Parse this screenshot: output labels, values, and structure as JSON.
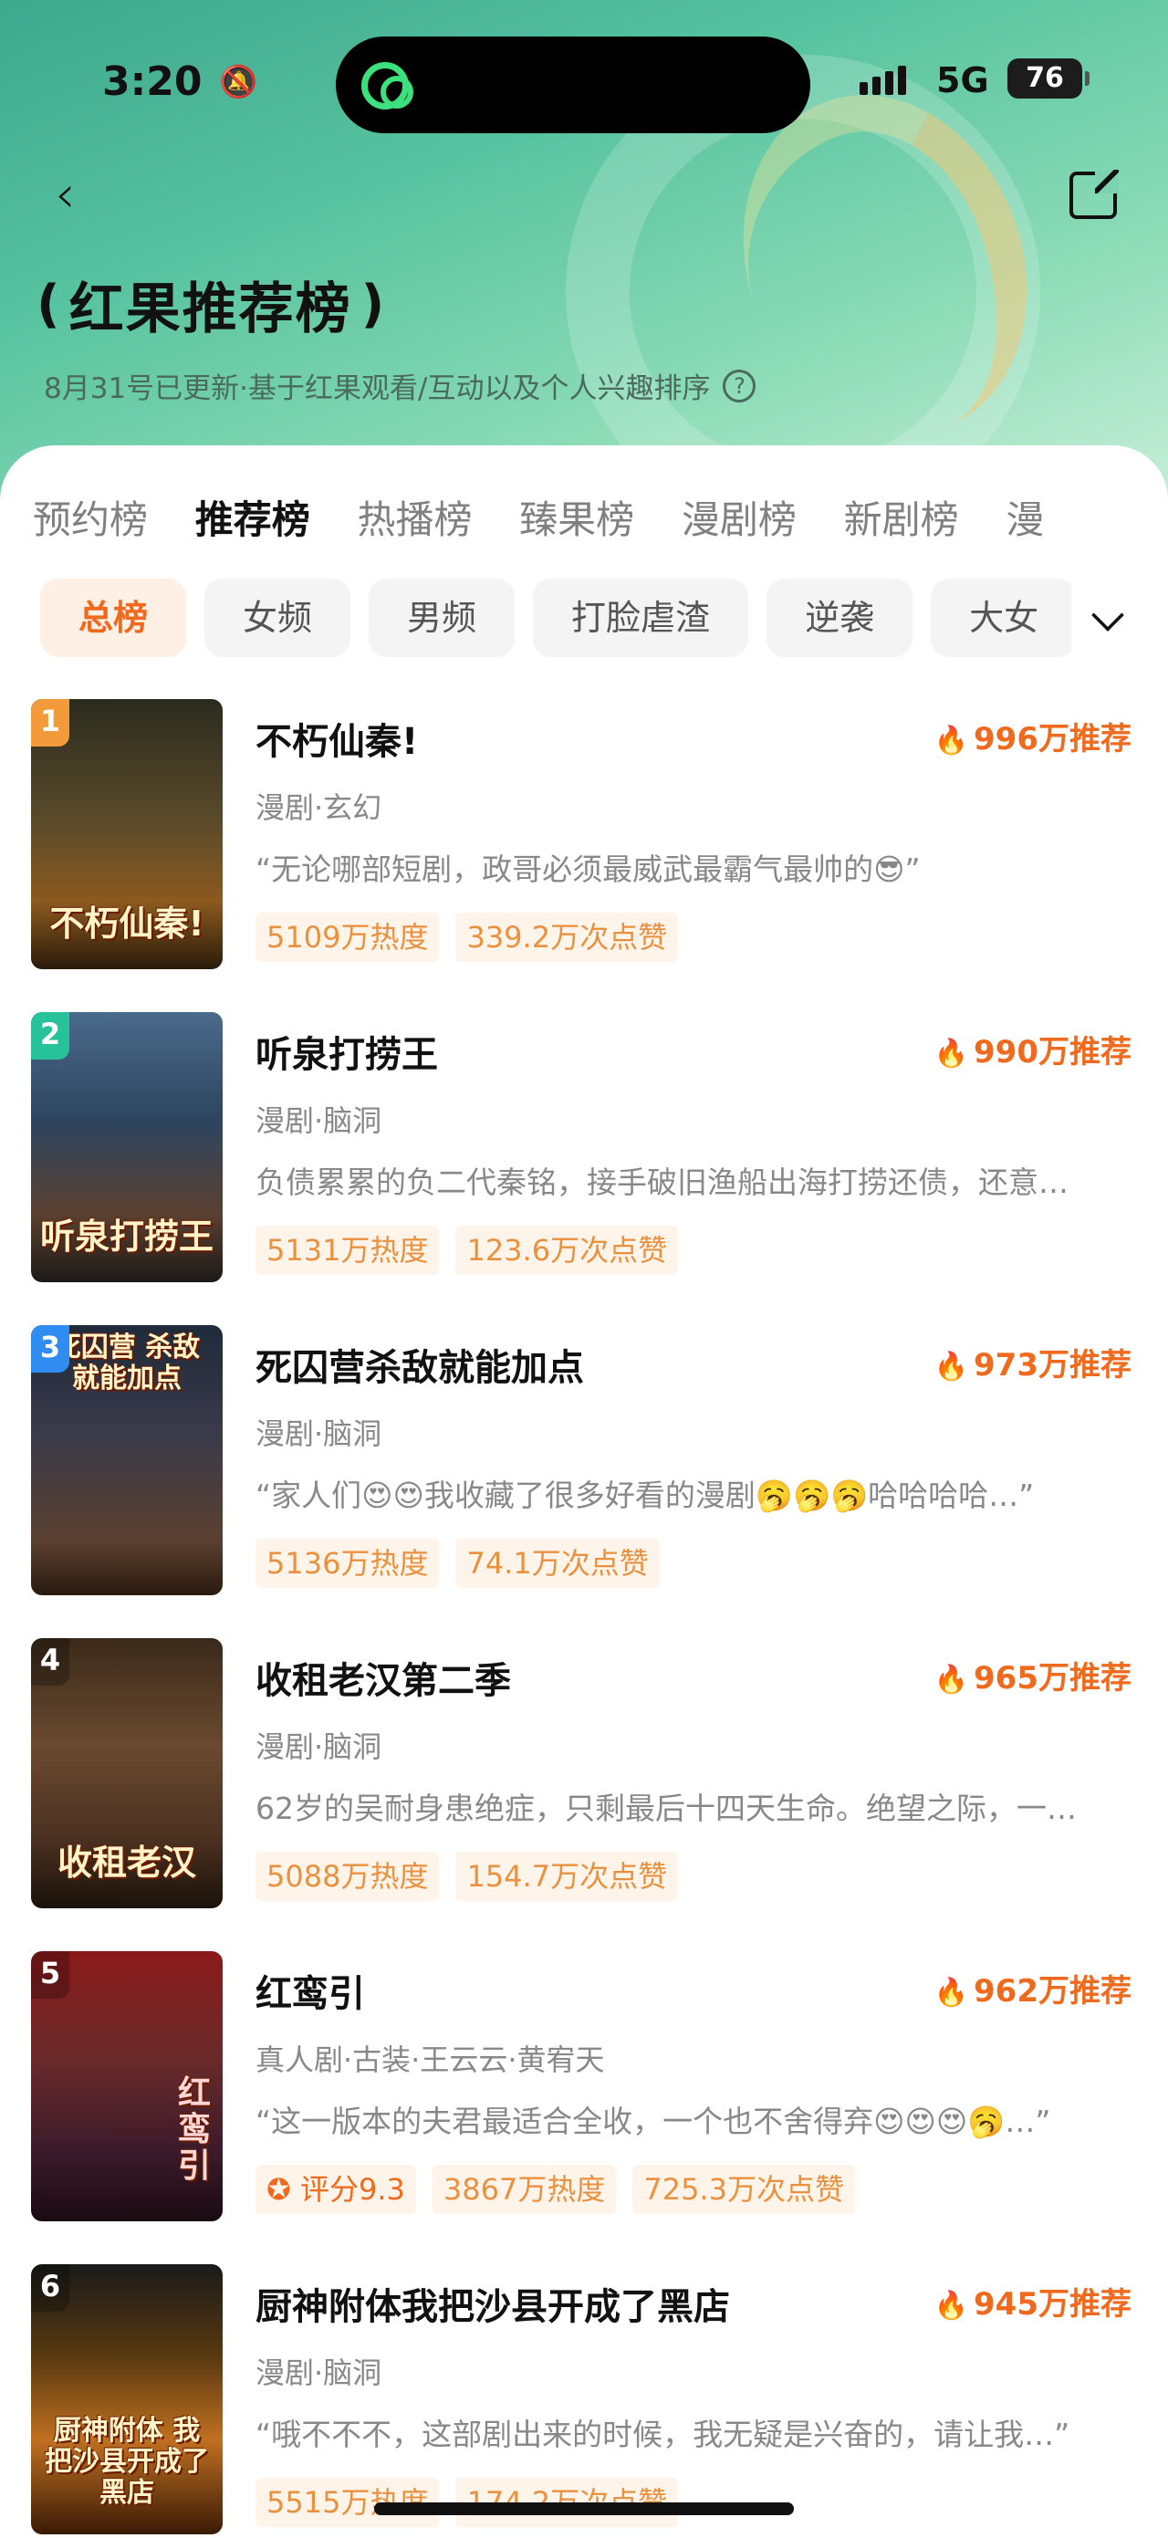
{
  "status_bar": {
    "time": "3:20",
    "network": "5G",
    "battery": "76"
  },
  "header": {
    "title": "红果推荐榜",
    "subtitle": "8月31号已更新·基于红果观看/互动以及个人兴趣排序"
  },
  "tabs": [
    "预约榜",
    "推荐榜",
    "热播榜",
    "臻果榜",
    "漫剧榜",
    "新剧榜",
    "漫"
  ],
  "active_tab": "推荐榜",
  "chips": [
    "总榜",
    "女频",
    "男频",
    "打脸虐渣",
    "逆袭",
    "大女"
  ],
  "active_chip": "总榜",
  "colors": {
    "accent": "#f06a1e",
    "rank1": "#f39a3a",
    "rank2": "#27c29a",
    "rank3": "#2f8cf0",
    "rank_other": "#555555"
  },
  "items": [
    {
      "rank": "1",
      "title": "不朽仙秦!",
      "score": "996万推荐",
      "genre": "漫剧·玄幻",
      "desc": "“无论哪部短剧，政哥必须最威武最霸气最帅的😎”",
      "tags": [
        "5109万热度",
        "339.2万次点赞"
      ],
      "cover_text": "不朽仙秦!"
    },
    {
      "rank": "2",
      "title": "听泉打捞王",
      "score": "990万推荐",
      "genre": "漫剧·脑洞",
      "desc": "负债累累的负二代秦铭，接手破旧渔船出海打捞还债，还意…",
      "tags": [
        "5131万热度",
        "123.6万次点赞"
      ],
      "cover_text": "听泉打捞王"
    },
    {
      "rank": "3",
      "title": "死囚营杀敌就能加点",
      "score": "973万推荐",
      "genre": "漫剧·脑洞",
      "desc": "“家人们😍😍我收藏了很多好看的漫剧🥱🥱🥱哈哈哈哈…”",
      "tags": [
        "5136万热度",
        "74.1万次点赞"
      ],
      "cover_text": "死囚营 杀敌就能加点"
    },
    {
      "rank": "4",
      "title": "收租老汉第二季",
      "score": "965万推荐",
      "genre": "漫剧·脑洞",
      "desc": "62岁的吴耐身患绝症，只剩最后十四天生命。绝望之际，一…",
      "tags": [
        "5088万热度",
        "154.7万次点赞"
      ],
      "cover_text": "收租老汉"
    },
    {
      "rank": "5",
      "title": "红鸾引",
      "score": "962万推荐",
      "genre": "真人剧·古装·王云云·黄宥天",
      "desc": "“这一版本的夫君最适合全收，一个也不舍得弃😍😍😍🥱…”",
      "tags": [
        "评分9.3",
        "3867万热度",
        "725.3万次点赞"
      ],
      "cover_text": "红鸾引"
    },
    {
      "rank": "6",
      "title": "厨神附体我把沙县开成了黑店",
      "score": "945万推荐",
      "genre": "漫剧·脑洞",
      "desc": "“哦不不不，这部剧出来的时候，我无疑是兴奋的，请让我…”",
      "tags": [
        "5515万热度",
        "174.2万次点赞"
      ],
      "cover_text": "厨神附体 我把沙县开成了黑店"
    }
  ]
}
